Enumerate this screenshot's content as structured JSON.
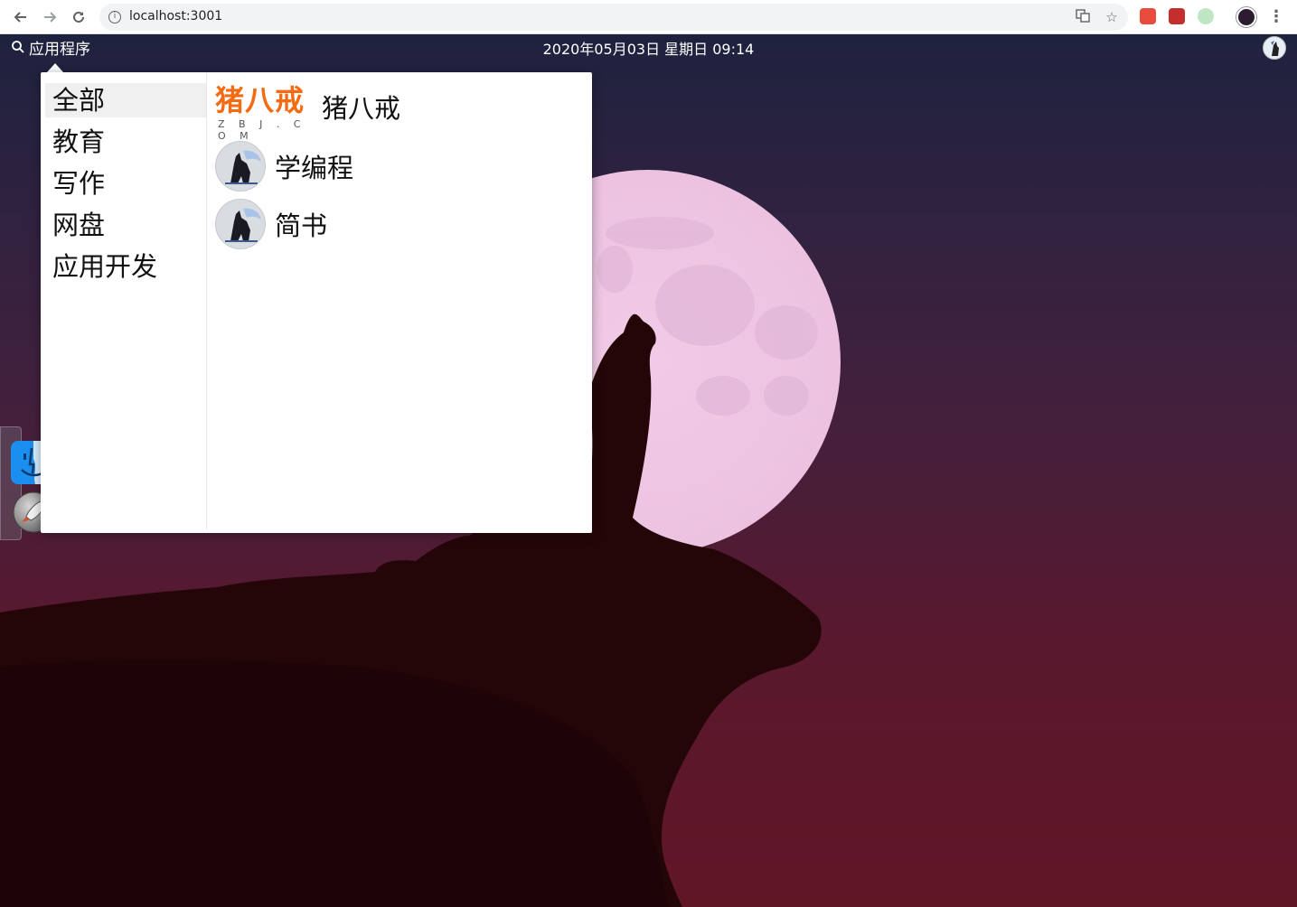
{
  "browser": {
    "url": "localhost:3001",
    "back_icon": "arrow-left-icon",
    "forward_icon": "arrow-right-icon",
    "reload_icon": "reload-icon",
    "extensions": [
      "translate-icon",
      "bookmark-star-icon",
      "extension-red-cube-icon",
      "extension-red-app-icon",
      "extension-green-icon"
    ]
  },
  "topbar": {
    "apps_label": "应用程序",
    "clock": "2020年05月03日 星期日 09:14"
  },
  "menu": {
    "categories": [
      {
        "label": "全部",
        "active": true
      },
      {
        "label": "教育",
        "active": false
      },
      {
        "label": "写作",
        "active": false
      },
      {
        "label": "网盘",
        "active": false
      },
      {
        "label": "应用开发",
        "active": false
      }
    ],
    "apps": [
      {
        "name": "猪八戒",
        "logo_text": "猪八戒",
        "logo_sub": "Z B J . C O M"
      },
      {
        "name": "学编程"
      },
      {
        "name": "简书"
      }
    ]
  },
  "colors": {
    "accent_orange": "#f56b13",
    "sky_top": "#1e223f",
    "sky_bottom": "#611626",
    "moon": "#f0c4e6"
  }
}
